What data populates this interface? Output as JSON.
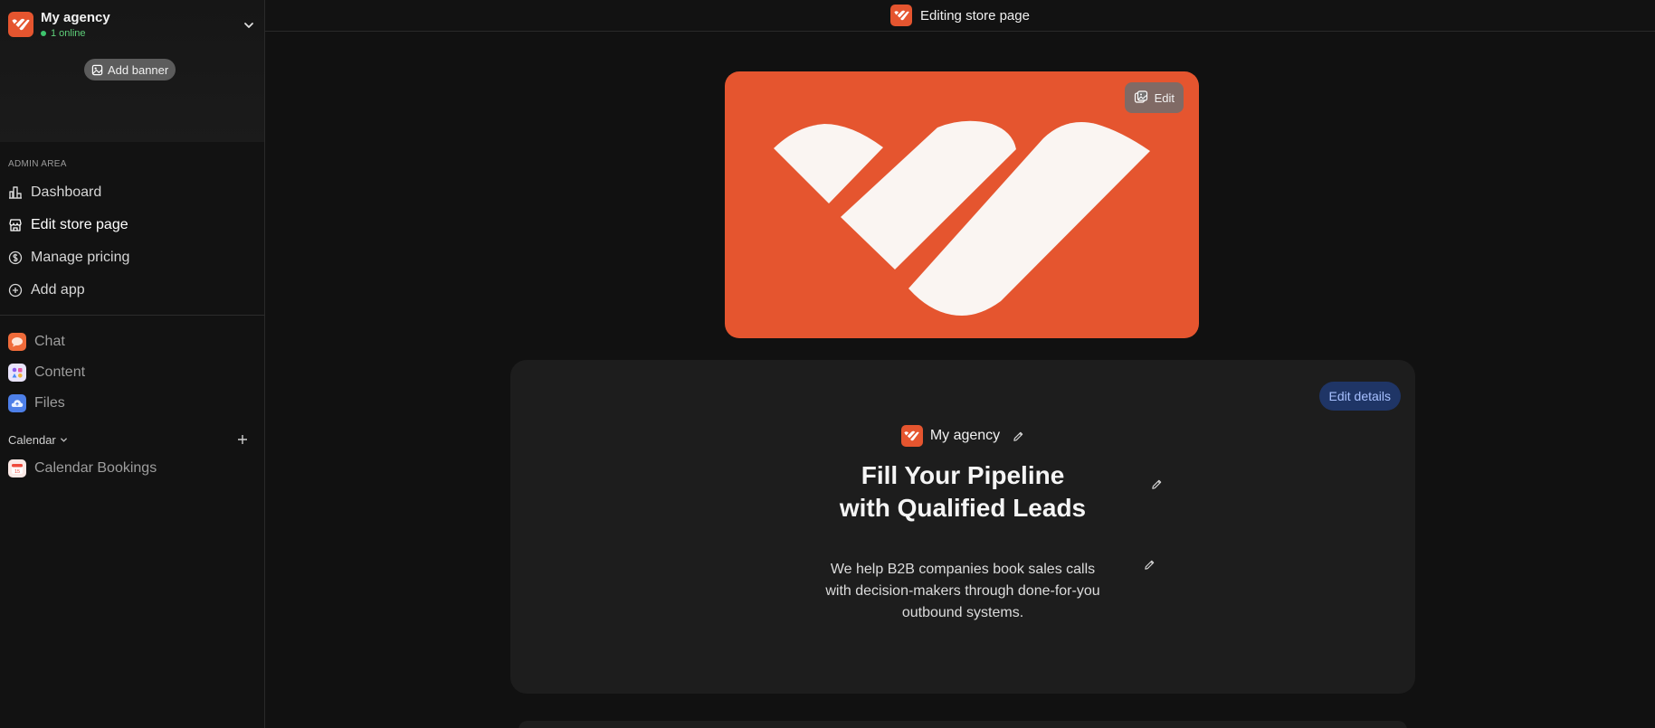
{
  "workspace": {
    "name": "My agency",
    "online_status": "1 online",
    "add_banner_label": "Add banner"
  },
  "sidebar": {
    "section_label": "ADMIN AREA",
    "admin_items": [
      {
        "label": "Dashboard",
        "icon": "bar-chart-icon"
      },
      {
        "label": "Edit store page",
        "icon": "store-icon"
      },
      {
        "label": "Manage pricing",
        "icon": "dollar-circle-icon"
      },
      {
        "label": "Add app",
        "icon": "plus-circle-icon"
      }
    ],
    "apps": [
      {
        "label": "Chat",
        "icon": "chat-app-icon"
      },
      {
        "label": "Content",
        "icon": "content-app-icon"
      },
      {
        "label": "Files",
        "icon": "files-app-icon"
      }
    ],
    "calendar_section": "Calendar",
    "calendar_items": [
      {
        "label": "Calendar Bookings",
        "icon": "calendar-app-icon"
      }
    ]
  },
  "topbar": {
    "title": "Editing store page"
  },
  "banner": {
    "edit_label": "Edit"
  },
  "store": {
    "edit_details_label": "Edit details",
    "name": "My agency",
    "headline_line1": "Fill Your Pipeline",
    "headline_line2": "with Qualified Leads",
    "description_line1": "We help B2B companies book sales calls",
    "description_line2": "with decision-makers through done-for-you",
    "description_line3": "outbound systems."
  },
  "colors": {
    "brand": "#e5552f",
    "background": "#111111",
    "card": "#1d1d1d",
    "accent_button_bg": "#1f3566",
    "accent_button_text": "#a7c0ff",
    "online": "#3ec46d"
  }
}
